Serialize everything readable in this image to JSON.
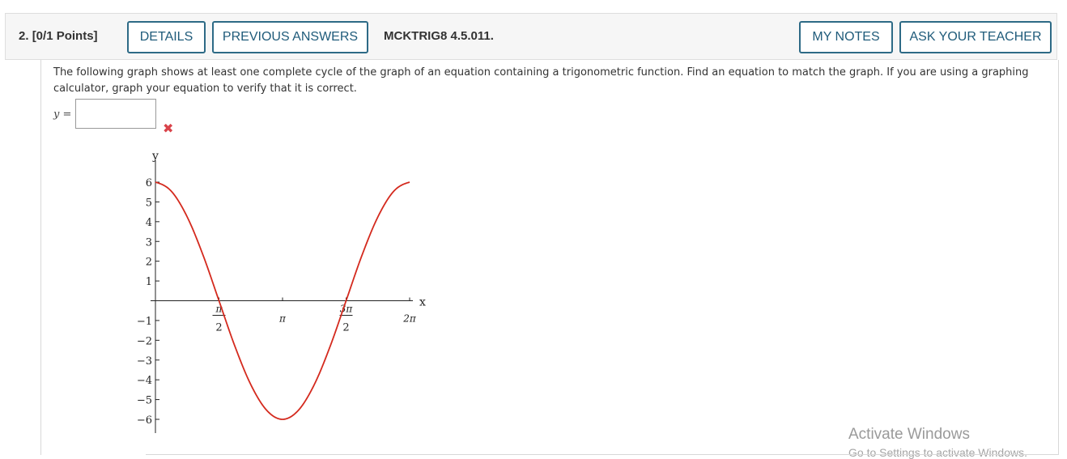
{
  "question": {
    "number": "2.",
    "points": "[0/1 Points]",
    "code": "MCKTRIG8 4.5.011."
  },
  "buttons": {
    "details": "DETAILS",
    "previous_answers": "PREVIOUS ANSWERS",
    "my_notes": "MY NOTES",
    "ask_teacher": "ASK YOUR TEACHER"
  },
  "prompt": "The following graph shows at least one complete cycle of the graph of an equation containing a trigonometric function. Find an equation to match the graph. If you are using a graphing calculator, graph your equation to verify that it is correct.",
  "answer": {
    "label": "y =",
    "value": "",
    "status_icon": "incorrect-x-icon",
    "status_color": "#d9434a"
  },
  "chart_data": {
    "type": "line",
    "xlabel": "x",
    "ylabel": "y",
    "xlim": [
      0,
      6.2832
    ],
    "ylim": [
      -6,
      6
    ],
    "x_ticks": [
      {
        "value": 1.5708,
        "num": "π",
        "den": "2"
      },
      {
        "value": 3.1416,
        "label": "π"
      },
      {
        "value": 4.7124,
        "num": "3π",
        "den": "2"
      },
      {
        "value": 6.2832,
        "label": "2π"
      }
    ],
    "y_ticks": [
      6,
      5,
      4,
      3,
      2,
      1,
      -1,
      -2,
      -3,
      -4,
      -5,
      -6
    ],
    "y_tick_labels": [
      "6",
      "5",
      "4",
      "3",
      "2",
      "1",
      "−1",
      "−2",
      "−3",
      "−4",
      "−5",
      "−6"
    ],
    "series": [
      {
        "color": "#d42a1e",
        "x": [
          0,
          0.3927,
          0.7854,
          1.1781,
          1.5708,
          1.9635,
          2.3562,
          2.7489,
          3.1416,
          3.5343,
          3.927,
          4.3197,
          4.7124,
          5.1051,
          5.4978,
          5.8905,
          6.2832
        ],
        "y": [
          6,
          5.54,
          4.24,
          2.3,
          0,
          -2.3,
          -4.24,
          -5.54,
          -6,
          -5.54,
          -4.24,
          -2.3,
          0,
          2.3,
          4.24,
          5.54,
          6
        ]
      }
    ],
    "grid": false
  },
  "watermark": {
    "line1": "Activate Windows",
    "line2": "Go to Settings to activate Windows."
  }
}
